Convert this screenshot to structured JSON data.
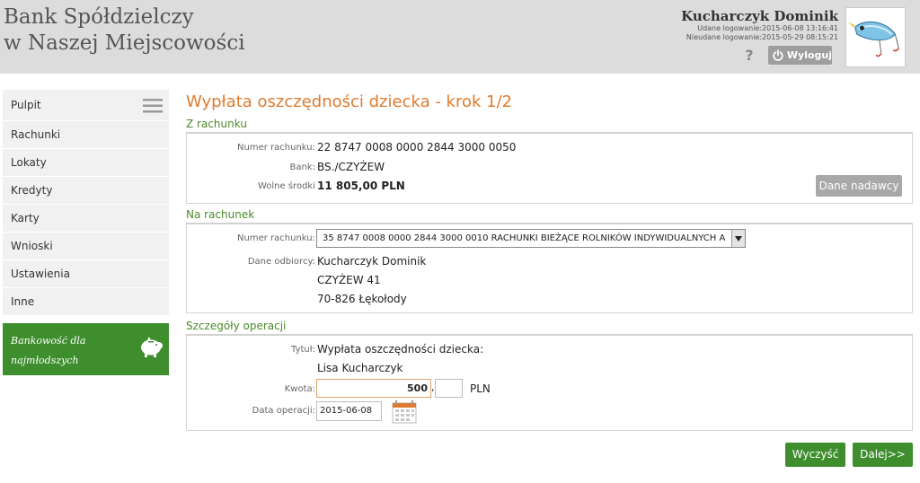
{
  "header": {
    "bank_name_line1": "Bank Spółdzielczy",
    "bank_name_line2": "w Naszej Miejscowości",
    "user_name": "Kucharczyk Dominik",
    "last_login": "Udane logowanie:2015-06-08 13:16:41",
    "failed_login": "Nieudane logowanie:2015-05-29 08:15:21",
    "help_symbol": "?",
    "logout_label": "Wyloguj",
    "icons": {
      "help": "question-icon",
      "logout": "power-icon",
      "logo": "fishing-lure-logo"
    }
  },
  "sidebar": {
    "items": [
      {
        "label": "Pulpit"
      },
      {
        "label": "Rachunki"
      },
      {
        "label": "Lokaty"
      },
      {
        "label": "Kredyty"
      },
      {
        "label": "Karty"
      },
      {
        "label": "Wnioski"
      },
      {
        "label": "Ustawienia"
      },
      {
        "label": "Inne"
      }
    ],
    "promo_line1": "Bankowość dla",
    "promo_line2": "najmłodszych",
    "icons": {
      "menu": "hamburger-icon",
      "promo": "piggy-bank-icon"
    }
  },
  "main": {
    "title": "Wypłata oszczędności dziecka - krok 1/2",
    "from": {
      "section": "Z rachunku",
      "account_label": "Numer rachunku:",
      "account_value": "22 8747 0008 0000 2844 3000 0050",
      "bank_label": "Bank:",
      "bank_value": "BS./CZYŻEW",
      "funds_label": "Wolne środki",
      "funds_value": "11 805,00 PLN",
      "sender_button": "Dane nadawcy"
    },
    "to": {
      "section": "Na rachunek",
      "account_label": "Numer rachunku:",
      "account_selected": "35 8747 0008 0000 2844 3000 0010 RACHUNKI BIEŻĄCE ROLNIKÓW INDYWIDUALNYCH A",
      "recipient_label": "Dane odbiorcy:",
      "recipient_line1": "Kucharczyk Dominik",
      "recipient_line2": "CZYŻEW 41",
      "recipient_line3": "70-826 Łękołody"
    },
    "details": {
      "section": "Szczegóły operacji",
      "title_label": "Tytuł:",
      "title_line1": "Wypłata oszczędności dziecka:",
      "title_line2": "Lisa Kucharczyk",
      "amount_label": "Kwota:",
      "amount_value": "500",
      "amount_separator": ",",
      "cents_value": "",
      "currency": "PLN",
      "date_label": "Data operacji:",
      "date_value": "2015-06-08",
      "icons": {
        "calendar": "calendar-icon"
      }
    },
    "buttons": {
      "clear": "Wyczyść",
      "next": "Dalej>>"
    }
  },
  "colors": {
    "accent_orange": "#e07b2e",
    "section_green": "#4a8a2a",
    "button_green": "#3e8e2e",
    "header_grey": "#dcdcdc"
  }
}
